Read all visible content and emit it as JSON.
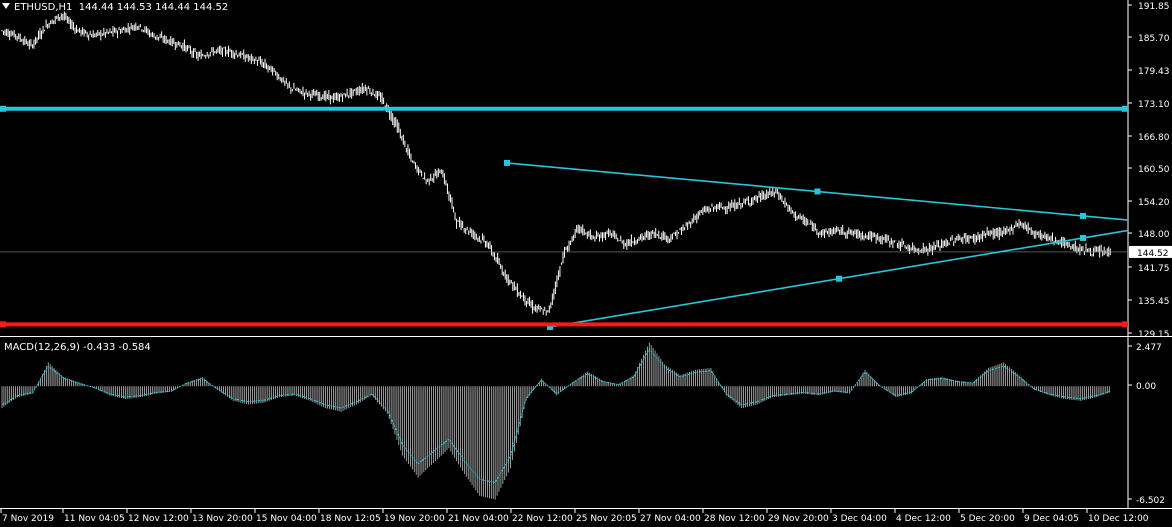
{
  "header": {
    "symbol": "ETHUSD,H1",
    "ohlc": "144.44 144.53 144.44 144.52"
  },
  "macd": {
    "label": "MACD(12,26,9) -0.433 -0.584",
    "axis_labels": [
      "2.477",
      "0.00",
      "-6.502"
    ]
  },
  "colors": {
    "background": "#000000",
    "candles": "#ffffff",
    "trendlines": "#29c5d8",
    "support": "#ff1a1a",
    "axis": "#ffffff",
    "grid": "#3a3a3a"
  },
  "chart_data": [
    {
      "type": "candlestick",
      "symbol": "ETHUSD",
      "timeframe": "H1",
      "y_ticks": [
        "191.85",
        "185.70",
        "179.43",
        "173.10",
        "166.80",
        "160.50",
        "154.20",
        "148.00",
        "141.75",
        "135.45",
        "129.15"
      ],
      "ylim": [
        129.15,
        191.85
      ],
      "current_price": "144.52",
      "x_ticks": [
        "7 Nov 2019",
        "11 Nov 04:05",
        "12 Nov 12:00",
        "13 Nov 20:00",
        "15 Nov 04:00",
        "18 Nov 12:05",
        "19 Nov 20:00",
        "21 Nov 04:00",
        "22 Nov 12:00",
        "25 Nov 20:05",
        "27 Nov 04:00",
        "28 Nov 12:00",
        "29 Nov 20:00",
        "3 Dec 04:00",
        "4 Dec 12:00",
        "5 Dec 20:00",
        "9 Dec 04:05",
        "10 Dec 12:00"
      ],
      "close_path": [
        187,
        186,
        184,
        188,
        190,
        187,
        186,
        186.5,
        187,
        188,
        186,
        185,
        184,
        182,
        183,
        183,
        182,
        181,
        179,
        176,
        175,
        174.5,
        174,
        175,
        176,
        174,
        169,
        162,
        158,
        160,
        150,
        148,
        146,
        141,
        137,
        134,
        133,
        144,
        149,
        147,
        148,
        146,
        147,
        148,
        147,
        149,
        152,
        153,
        153,
        154,
        155,
        156,
        152,
        150,
        148,
        148.5,
        148,
        147.5,
        147,
        146,
        145,
        145,
        146,
        147,
        147,
        148,
        148,
        150,
        148,
        147,
        146,
        145,
        144.5,
        144.5
      ],
      "lines": [
        {
          "name": "upper-trendline",
          "points": [
            [
              "21 Nov 04:00",
              161.5
            ],
            [
              "10 Dec 12:00",
              150.5
            ]
          ]
        },
        {
          "name": "lower-trendline",
          "points": [
            [
              "22 Nov 12:00",
              130.3
            ],
            [
              "10 Dec 12:00",
              148.5
            ]
          ]
        },
        {
          "name": "resistance",
          "value": 172.0
        },
        {
          "name": "support",
          "value": 130.8
        }
      ]
    },
    {
      "type": "bar",
      "title": "MACD(12,26,9)",
      "values_summary": {
        "main": -0.433,
        "signal": -0.584
      },
      "ylim": [
        -6.502,
        2.477
      ],
      "histogram": [
        -1.2,
        -0.6,
        -0.4,
        1.3,
        0.5,
        0.2,
        -0.1,
        -0.5,
        -0.7,
        -0.6,
        -0.4,
        -0.3,
        0.2,
        0.5,
        -0.2,
        -0.8,
        -1.0,
        -0.9,
        -0.6,
        -0.5,
        -0.8,
        -1.2,
        -1.4,
        -1.0,
        -0.5,
        -1.5,
        -3.8,
        -5.0,
        -4.2,
        -3.4,
        -4.8,
        -6.0,
        -6.2,
        -4.5,
        -0.8,
        0.4,
        -0.5,
        0.2,
        0.8,
        0.3,
        0.1,
        0.6,
        2.4,
        1.2,
        0.6,
        0.9,
        1.0,
        -0.5,
        -1.2,
        -1.0,
        -0.6,
        -0.5,
        -0.4,
        -0.5,
        -0.3,
        -0.4,
        0.9,
        0.0,
        -0.6,
        -0.4,
        0.4,
        0.5,
        0.3,
        0.2,
        1.0,
        1.3,
        0.6,
        -0.2,
        -0.5,
        -0.7,
        -0.8,
        -0.6,
        -0.3
      ]
    }
  ]
}
